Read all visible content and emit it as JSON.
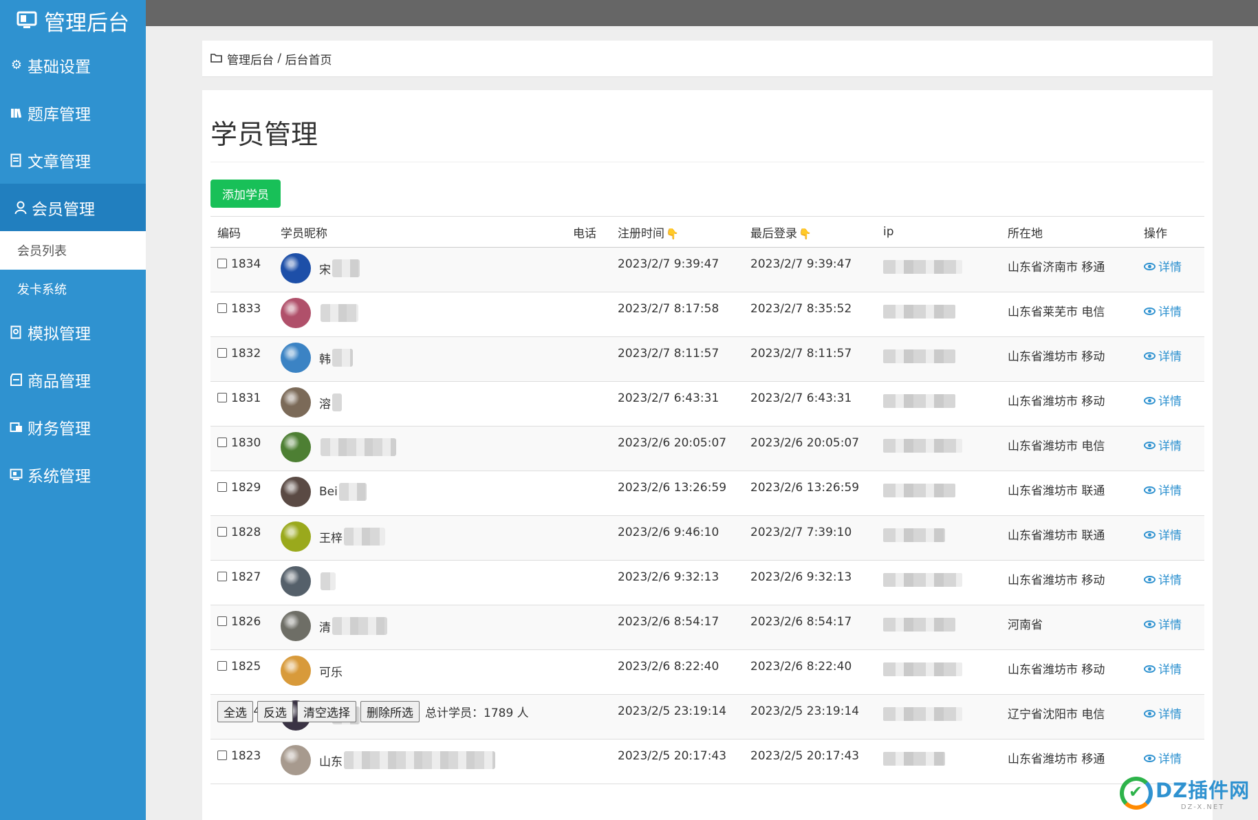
{
  "app": {
    "title": "管理后台"
  },
  "sidebar": {
    "items": [
      {
        "label": "基础设置",
        "icon": "gear-icon"
      },
      {
        "label": "题库管理",
        "icon": "books-icon"
      },
      {
        "label": "文章管理",
        "icon": "document-icon"
      },
      {
        "label": "会员管理",
        "icon": "user-icon"
      },
      {
        "label": "模拟管理",
        "icon": "exam-icon"
      },
      {
        "label": "商品管理",
        "icon": "goods-icon"
      },
      {
        "label": "财务管理",
        "icon": "finance-icon"
      },
      {
        "label": "系统管理",
        "icon": "system-icon"
      }
    ],
    "submenu": [
      {
        "label": "会员列表"
      },
      {
        "label": "发卡系统"
      }
    ]
  },
  "breadcrumb": {
    "root": "管理后台",
    "sep": " / ",
    "current": "后台首页"
  },
  "page": {
    "title": "学员管理",
    "add_button": "添加学员"
  },
  "table": {
    "headers": [
      "编码",
      "学员昵称",
      "电话",
      "注册时间",
      "最后登录",
      "ip",
      "所在地",
      "操作"
    ],
    "detail_label": "详情",
    "rows": [
      {
        "id": "1834",
        "name_visible": "宋",
        "phone": "",
        "register": "2023/2/7 9:39:47",
        "last_login": "2023/2/7 9:39:47",
        "location": "山东省济南市 移通",
        "avatar_color": "#1d4fa8"
      },
      {
        "id": "1833",
        "name_visible": "",
        "phone": "",
        "register": "2023/2/7 8:17:58",
        "last_login": "2023/2/7 8:35:52",
        "location": "山东省莱芜市 电信",
        "avatar_color": "#b0506a"
      },
      {
        "id": "1832",
        "name_visible": "韩",
        "phone": "",
        "register": "2023/2/7 8:11:57",
        "last_login": "2023/2/7 8:11:57",
        "location": "山东省潍坊市 移动",
        "avatar_color": "#3b83c4"
      },
      {
        "id": "1831",
        "name_visible": "溶",
        "phone": "",
        "register": "2023/2/7 6:43:31",
        "last_login": "2023/2/7 6:43:31",
        "location": "山东省潍坊市 移动",
        "avatar_color": "#7b6a58"
      },
      {
        "id": "1830",
        "name_visible": "",
        "phone": "",
        "register": "2023/2/6 20:05:07",
        "last_login": "2023/2/6 20:05:07",
        "location": "山东省潍坊市 电信",
        "avatar_color": "#4d7f33"
      },
      {
        "id": "1829",
        "name_visible": "Bei",
        "phone": "",
        "register": "2023/2/6 13:26:59",
        "last_login": "2023/2/6 13:26:59",
        "location": "山东省潍坊市 联通",
        "avatar_color": "#5a4a44"
      },
      {
        "id": "1828",
        "name_visible": "王梓",
        "phone": "",
        "register": "2023/2/6 9:46:10",
        "last_login": "2023/2/7 7:39:10",
        "location": "山东省潍坊市 联通",
        "avatar_color": "#9aa91c"
      },
      {
        "id": "1827",
        "name_visible": "",
        "phone": "",
        "register": "2023/2/6 9:32:13",
        "last_login": "2023/2/6 9:32:13",
        "location": "山东省潍坊市 移动",
        "avatar_color": "#55606a"
      },
      {
        "id": "1826",
        "name_visible": "清",
        "phone": "",
        "register": "2023/2/6 8:54:17",
        "last_login": "2023/2/6 8:54:17",
        "location": "河南省",
        "avatar_color": "#6e6e66"
      },
      {
        "id": "1825",
        "name_visible": "可乐",
        "phone": "",
        "register": "2023/2/6 8:22:40",
        "last_login": "2023/2/6 8:22:40",
        "location": "山东省潍坊市 移动",
        "avatar_color": "#d89a3a"
      },
      {
        "id": "1824",
        "name_visible": "飞",
        "phone": "",
        "register": "2023/2/5 23:19:14",
        "last_login": "2023/2/5 23:19:14",
        "location": "辽宁省沈阳市 电信",
        "avatar_color": "#3a3344"
      },
      {
        "id": "1823",
        "name_visible": "山东",
        "phone": "",
        "register": "2023/2/5 20:17:43",
        "last_login": "2023/2/5 20:17:43",
        "location": "山东省潍坊市 移通",
        "avatar_color": "#a79a8e"
      }
    ]
  },
  "footer": {
    "buttons": [
      "全选",
      "反选",
      "清空选择",
      "删除所选"
    ],
    "total_label": "总计学员：1789 人"
  },
  "watermark": {
    "text": "DZ插件网",
    "sub": "DZ-X.NET"
  },
  "colors": {
    "sidebar": "#2f92d0",
    "sidebar_active": "#217fbf",
    "add_button": "#18c058",
    "link": "#2f92d0",
    "topbar": "#666666",
    "sort_icon": "#f2b400"
  }
}
